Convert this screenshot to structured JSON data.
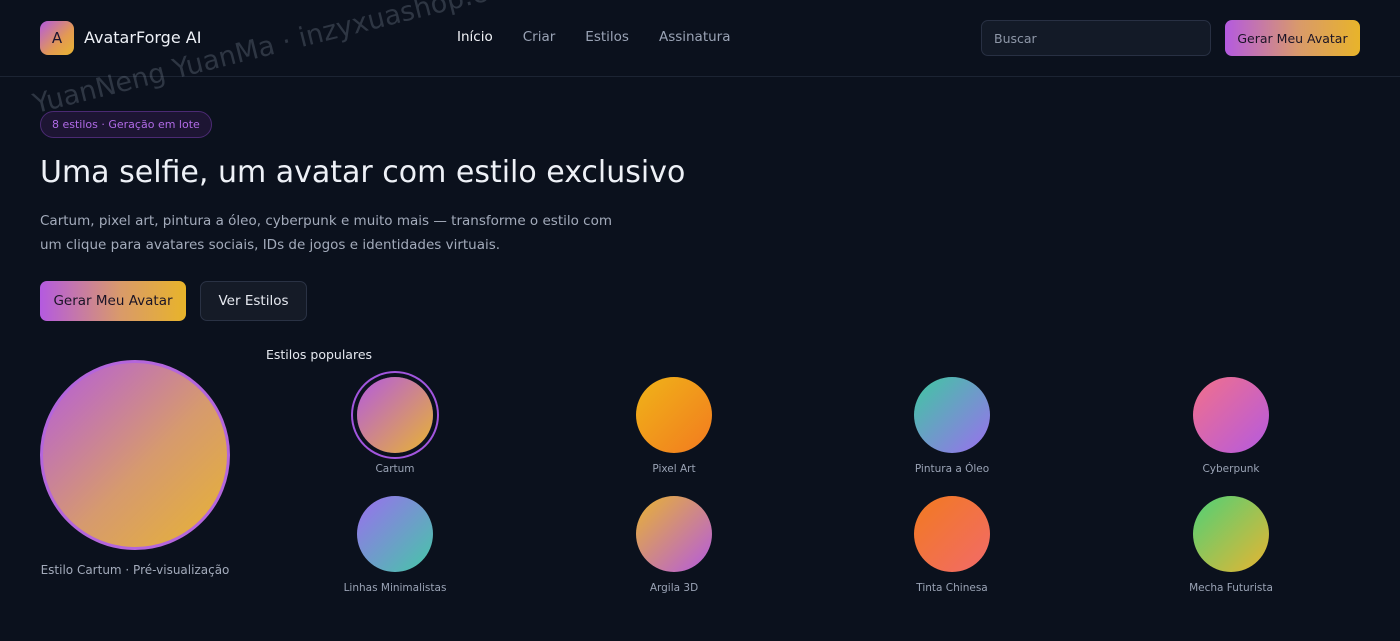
{
  "header": {
    "logo_letter": "A",
    "app_name": "AvatarForge AI",
    "nav": [
      "Início",
      "Criar",
      "Estilos",
      "Assinatura"
    ],
    "search_placeholder": "Buscar",
    "cta_label": "Gerar Meu Avatar"
  },
  "hero": {
    "badge": "8 estilos · Geração em lote",
    "title": "Uma selfie, um avatar com estilo exclusivo",
    "description": "Cartum, pixel art, pintura a óleo, cyberpunk e muito mais — transforme o estilo com um clique para avatares sociais, IDs de jogos e identidades virtuais.",
    "primary_button": "Gerar Meu Avatar",
    "secondary_button": "Ver Estilos"
  },
  "preview": {
    "caption": "Estilo Cartum · Pré-visualização",
    "colors": [
      "#b45ae0",
      "#e8b431"
    ]
  },
  "styles": {
    "title": "Estilos populares",
    "items": [
      {
        "label": "Cartum",
        "selected": true,
        "colors": [
          "#b45ae0",
          "#e8b431"
        ]
      },
      {
        "label": "Pixel Art",
        "selected": false,
        "colors": [
          "#f0b418",
          "#f27a1f"
        ]
      },
      {
        "label": "Pintura a Óleo",
        "selected": false,
        "colors": [
          "#3ec9a0",
          "#9b6ef0"
        ]
      },
      {
        "label": "Cyberpunk",
        "selected": false,
        "colors": [
          "#f2708a",
          "#b45ae0"
        ]
      },
      {
        "label": "Linhas Minimalistas",
        "selected": false,
        "colors": [
          "#9b6ef0",
          "#44c8a6"
        ]
      },
      {
        "label": "Argila 3D",
        "selected": false,
        "colors": [
          "#e8b431",
          "#b45ae0"
        ]
      },
      {
        "label": "Tinta Chinesa",
        "selected": false,
        "colors": [
          "#f27a1f",
          "#f26a6a"
        ]
      },
      {
        "label": "Mecha Futurista",
        "selected": false,
        "colors": [
          "#4fd177",
          "#e8b431"
        ]
      }
    ]
  },
  "watermark": "YuanNeng YuanMa · inzyxuashop.com"
}
